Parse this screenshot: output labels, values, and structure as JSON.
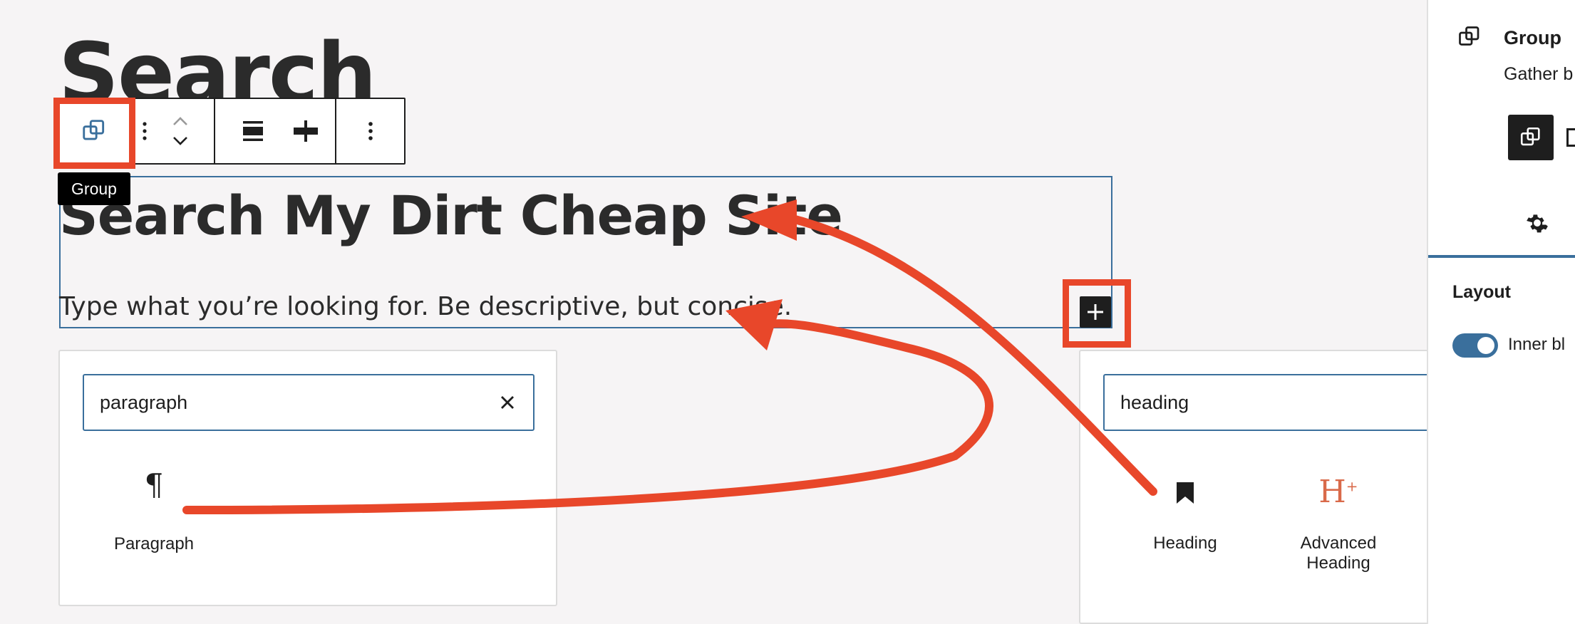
{
  "canvas": {
    "page_title": "Search",
    "heading": "Search My Dirt Cheap Site",
    "paragraph": "Type what you’re looking for. Be descriptive, but concise."
  },
  "toolbar": {
    "block_icon": "group-icon",
    "tooltip": "Group",
    "buttons": [
      "drag-handle-icon",
      "move-up-icon",
      "move-down-icon",
      "align-icon",
      "justify-icon",
      "more-options-icon"
    ]
  },
  "inserter_left": {
    "search_value": "paragraph",
    "results": [
      {
        "label": "Paragraph",
        "icon": "paragraph-icon"
      }
    ]
  },
  "inserter_right": {
    "search_value": "heading",
    "results": [
      {
        "label": "Heading",
        "icon": "bookmark-icon"
      },
      {
        "label": "Advanced Heading",
        "icon": "advanced-heading-icon"
      }
    ]
  },
  "sidebar": {
    "block_name": "Group",
    "block_desc": "Gather b",
    "section": "Layout",
    "toggle_label": "Inner bl"
  },
  "colors": {
    "accent": "#3a6f9c",
    "annotation": "#e8472a",
    "dark": "#1e1e1e"
  }
}
